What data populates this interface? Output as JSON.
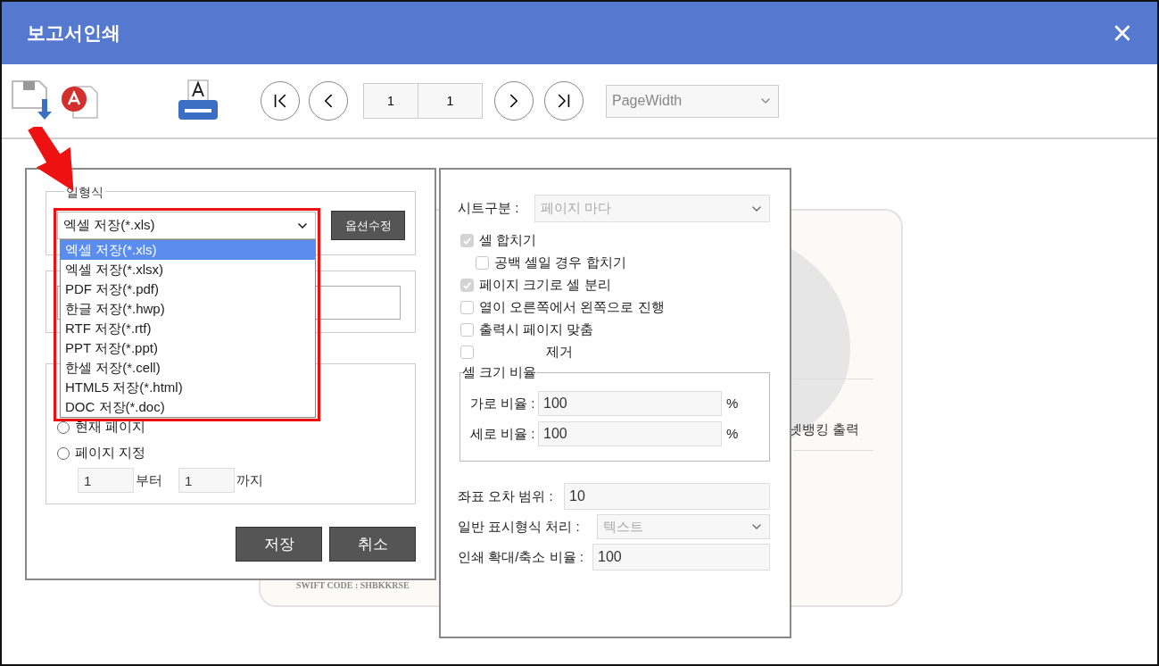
{
  "window": {
    "title": "보고서인쇄",
    "close": "×"
  },
  "toolbar": {
    "page_current": "1",
    "page_total": "1",
    "zoom": "PageWidth"
  },
  "document": {
    "texts": [
      "넷뱅킹 출력",
      "SWIFT CODE : SHBKKRSE"
    ]
  },
  "export_dialog": {
    "format_legend": "일형식",
    "format_select": {
      "value": "엑셀 저장(*.xls)",
      "options": [
        {
          "label": "엑셀 저장(*.xls)",
          "selected": true
        },
        {
          "label": "엑셀 저장(*.xlsx)",
          "selected": false
        },
        {
          "label": "PDF 저장(*.pdf)",
          "selected": false
        },
        {
          "label": "한글 저장(*.hwp)",
          "selected": false
        },
        {
          "label": "RTF 저장(*.rtf)",
          "selected": false
        },
        {
          "label": "PPT 저장(*.ppt)",
          "selected": false
        },
        {
          "label": "한셀 저장(*.cell)",
          "selected": false
        },
        {
          "label": "HTML5 저장(*.html)",
          "selected": false
        },
        {
          "label": "DOC 저장(*.doc)",
          "selected": false
        }
      ]
    },
    "option_button": "옵션수정",
    "range_options": [
      {
        "label": "현재 페이지",
        "selected": false
      },
      {
        "label": "페이지 지정",
        "selected": false
      }
    ],
    "range_from": "1",
    "from_label": "부터",
    "range_to": "1",
    "to_label": "까지",
    "buttons": [
      "저장",
      "취소"
    ]
  },
  "options_dialog": {
    "sheet_label": "시트구분 :",
    "sheet_value": "페이지 마다",
    "checks": [
      {
        "label": "셀 합치기",
        "checked": true,
        "disabled": true,
        "children": [
          {
            "label": "공백 셀일 경우 합치기",
            "checked": false,
            "disabled": false
          }
        ]
      },
      {
        "label": "페이지 크기로 셀 분리",
        "checked": true,
        "disabled": true
      },
      {
        "label": "열이 오른쪽에서 왼쪽으로 진행",
        "checked": false,
        "disabled": false
      },
      {
        "label": "출력시 페이지 맞춤",
        "checked": false,
        "disabled": false
      },
      {
        "label": "제거",
        "checked": false,
        "disabled": false
      }
    ],
    "ratio_legend": "셀 크기 비율",
    "ratios": [
      {
        "label": "가로 비율 :",
        "value": "100",
        "unit": "%"
      },
      {
        "label": "세로 비율 :",
        "value": "100",
        "unit": "%"
      }
    ],
    "fields": [
      {
        "kind": "input",
        "label": "좌표 오차 범위 :",
        "value": "10"
      },
      {
        "kind": "select",
        "label": "일반 표시형식 처리 :",
        "value": "텍스트"
      },
      {
        "kind": "input",
        "label": "인쇄 확대/축소 비율 :",
        "value": "100"
      }
    ]
  }
}
